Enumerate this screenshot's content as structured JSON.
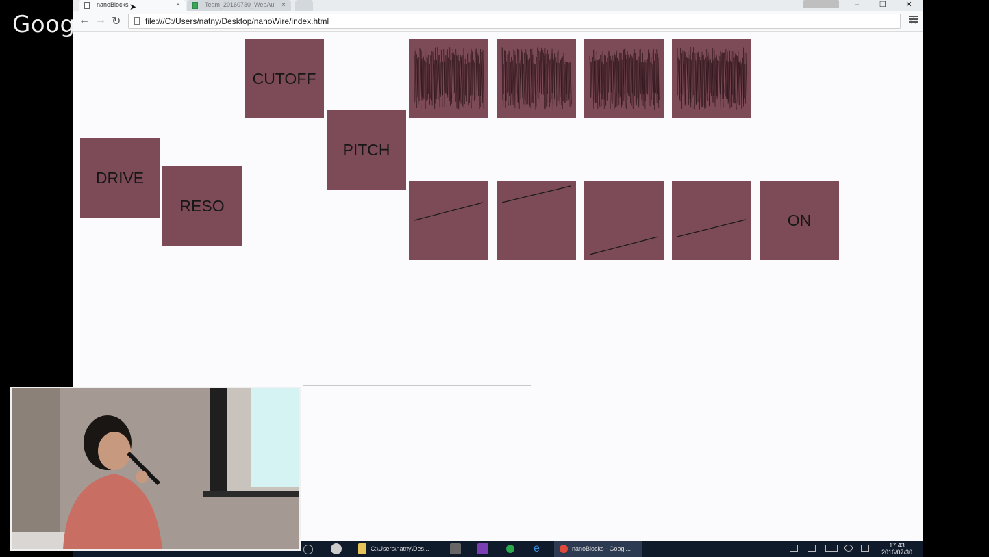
{
  "overlay": {
    "logo": "Goog"
  },
  "browser": {
    "tabs": [
      {
        "label": "nanoBlocks",
        "close": "×"
      },
      {
        "label": "Team_20160730_WebAu",
        "close": "×"
      }
    ],
    "address": "file:///C:/Users/natny/Desktop/nanoWire/index.html",
    "nav": {
      "back": "←",
      "forward": "→",
      "reload": "↻"
    },
    "star": "☆",
    "window_buttons": {
      "minimize": "–",
      "restore": "❐",
      "close": "✕"
    }
  },
  "blocks": [
    {
      "id": "cutoff",
      "label": "CUTOFF"
    },
    {
      "id": "pitch",
      "label": "PITCH"
    },
    {
      "id": "drive",
      "label": "DRIVE"
    },
    {
      "id": "reso",
      "label": "RESO"
    },
    {
      "id": "wave-1",
      "label": ""
    },
    {
      "id": "wave-2",
      "label": ""
    },
    {
      "id": "wave-3",
      "label": ""
    },
    {
      "id": "wave-4",
      "label": ""
    },
    {
      "id": "line-1",
      "label": ""
    },
    {
      "id": "line-2",
      "label": ""
    },
    {
      "id": "line-3",
      "label": ""
    },
    {
      "id": "line-4",
      "label": ""
    },
    {
      "id": "on",
      "label": "ON"
    }
  ],
  "taskbar": {
    "explorer_label": "C:\\Users\\natny\\Des...",
    "chrome_label": "nanoBlocks - Googl...",
    "time": "17:43",
    "date": "2016/07/30"
  },
  "colors": {
    "block": "#7c4b57",
    "page": "#fbfbfd",
    "taskbar": "#0f1a2b"
  }
}
